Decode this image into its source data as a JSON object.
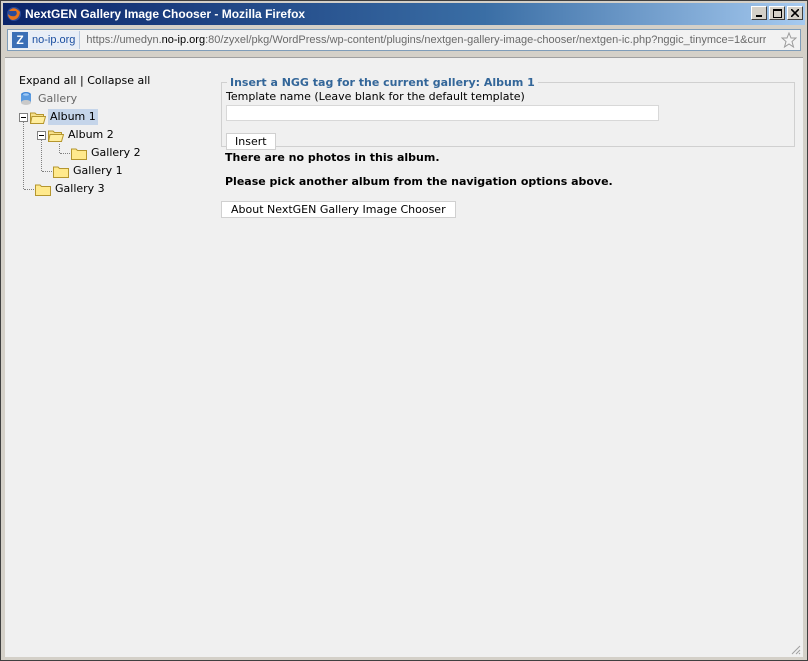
{
  "window": {
    "title": "NextGEN Gallery Image Chooser - Mozilla Firefox"
  },
  "urlbar": {
    "site_identity": "no-ip.org",
    "url_prefix": "https://umedyn.",
    "url_domain": "no-ip.org",
    "url_rest": ":80/zyxel/pkg/WordPress/wp-content/plugins/nextgen-gallery-image-chooser/nextgen-ic.php?nggic_tinymce=1&curr"
  },
  "tree": {
    "expand_all": "Expand all",
    "separator": "|",
    "collapse_all": "Collapse all",
    "root": "Gallery",
    "nodes": [
      {
        "label": "Album 1",
        "type": "album",
        "selected": true
      },
      {
        "label": "Album 2",
        "type": "album"
      },
      {
        "label": "Gallery 2",
        "type": "gallery"
      },
      {
        "label": "Gallery 1",
        "type": "gallery"
      },
      {
        "label": "Gallery 3",
        "type": "gallery"
      }
    ]
  },
  "main": {
    "legend": "Insert a NGG tag for the current gallery: Album 1",
    "template_label": "Template name (Leave blank for the default template)",
    "template_value": "",
    "insert_label": "Insert",
    "no_photos": "There are no photos in this album.",
    "pick_another": "Please pick another album from the navigation options above.",
    "about_label": "About NextGEN Gallery Image Chooser"
  },
  "colors": {
    "titlebar_start": "#0a246a",
    "legend": "#336699",
    "selected_node": "#c5d5ea"
  }
}
